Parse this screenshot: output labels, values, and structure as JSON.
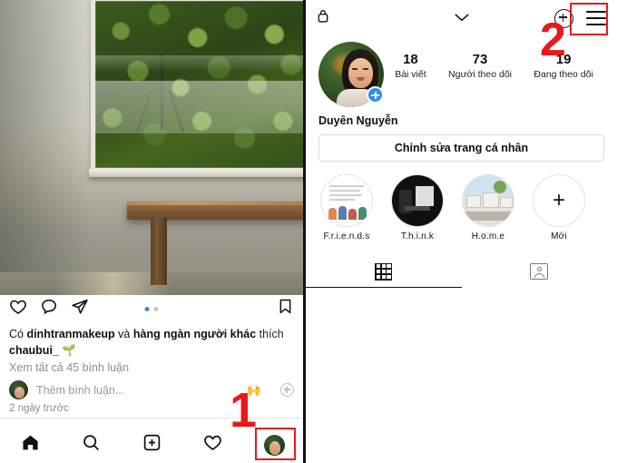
{
  "left_panel": {
    "post": {
      "action_icons": [
        "heart-icon",
        "comment-icon",
        "share-icon",
        "bookmark-icon"
      ],
      "pagination": {
        "total": 2,
        "active_index": 0,
        "active_color": "#2d8cf0",
        "inactive_color": "#c7c7c7"
      },
      "caption_prefix": "Có ",
      "caption_user": "dinhtranmakeup",
      "caption_mid": " và ",
      "caption_bold": "hàng ngàn người khác",
      "caption_suffix": " thích",
      "caption_line2": "chaubui_",
      "caption_emoji": "🌱",
      "view_comments": "Xem tất cả 45 bình luận",
      "comment_placeholder": "Thêm bình luận...",
      "quick_emoji": "🙌",
      "timestamp": "2 ngày trước"
    },
    "bottom_nav": [
      {
        "name": "home",
        "icon": "home-icon"
      },
      {
        "name": "search",
        "icon": "search-icon"
      },
      {
        "name": "create",
        "icon": "plus-square-icon"
      },
      {
        "name": "activity",
        "icon": "heart-icon"
      },
      {
        "name": "profile",
        "icon": "profile-avatar-icon"
      }
    ],
    "annotation": {
      "number": "1",
      "highlight_color": "#e8191a",
      "target": "profile-tab"
    }
  },
  "right_panel": {
    "header": {
      "lock_icon": "lock-icon",
      "chevron_icon": "chevron-down-icon",
      "add_icon": "plus-circle-icon",
      "menu_icon": "hamburger-menu-icon"
    },
    "profile": {
      "avatar_badge": "plus-badge-icon",
      "display_name": "Duyên Nguyễn",
      "edit_button": "Chỉnh sửa trang cá nhân",
      "stats": [
        {
          "value": "18",
          "label": "Bài viết"
        },
        {
          "value": "73",
          "label": "Người theo dõi"
        },
        {
          "value": "19",
          "label": "Đang theo dõi"
        }
      ]
    },
    "highlights": [
      {
        "label": "F.r.i.e.n.d.s",
        "thumb": "friends-thumb"
      },
      {
        "label": "T.h.i.n.k",
        "thumb": "think-thumb"
      },
      {
        "label": "H.o.m.e",
        "thumb": "home-thumb"
      },
      {
        "label": "Mới",
        "thumb": "plus-icon"
      }
    ],
    "tabs": [
      {
        "name": "grid",
        "icon": "grid-icon",
        "active": true
      },
      {
        "name": "tagged",
        "icon": "tagged-person-icon",
        "active": false
      }
    ],
    "annotation": {
      "number": "2",
      "highlight_color": "#e8191a",
      "target": "hamburger-menu"
    }
  }
}
